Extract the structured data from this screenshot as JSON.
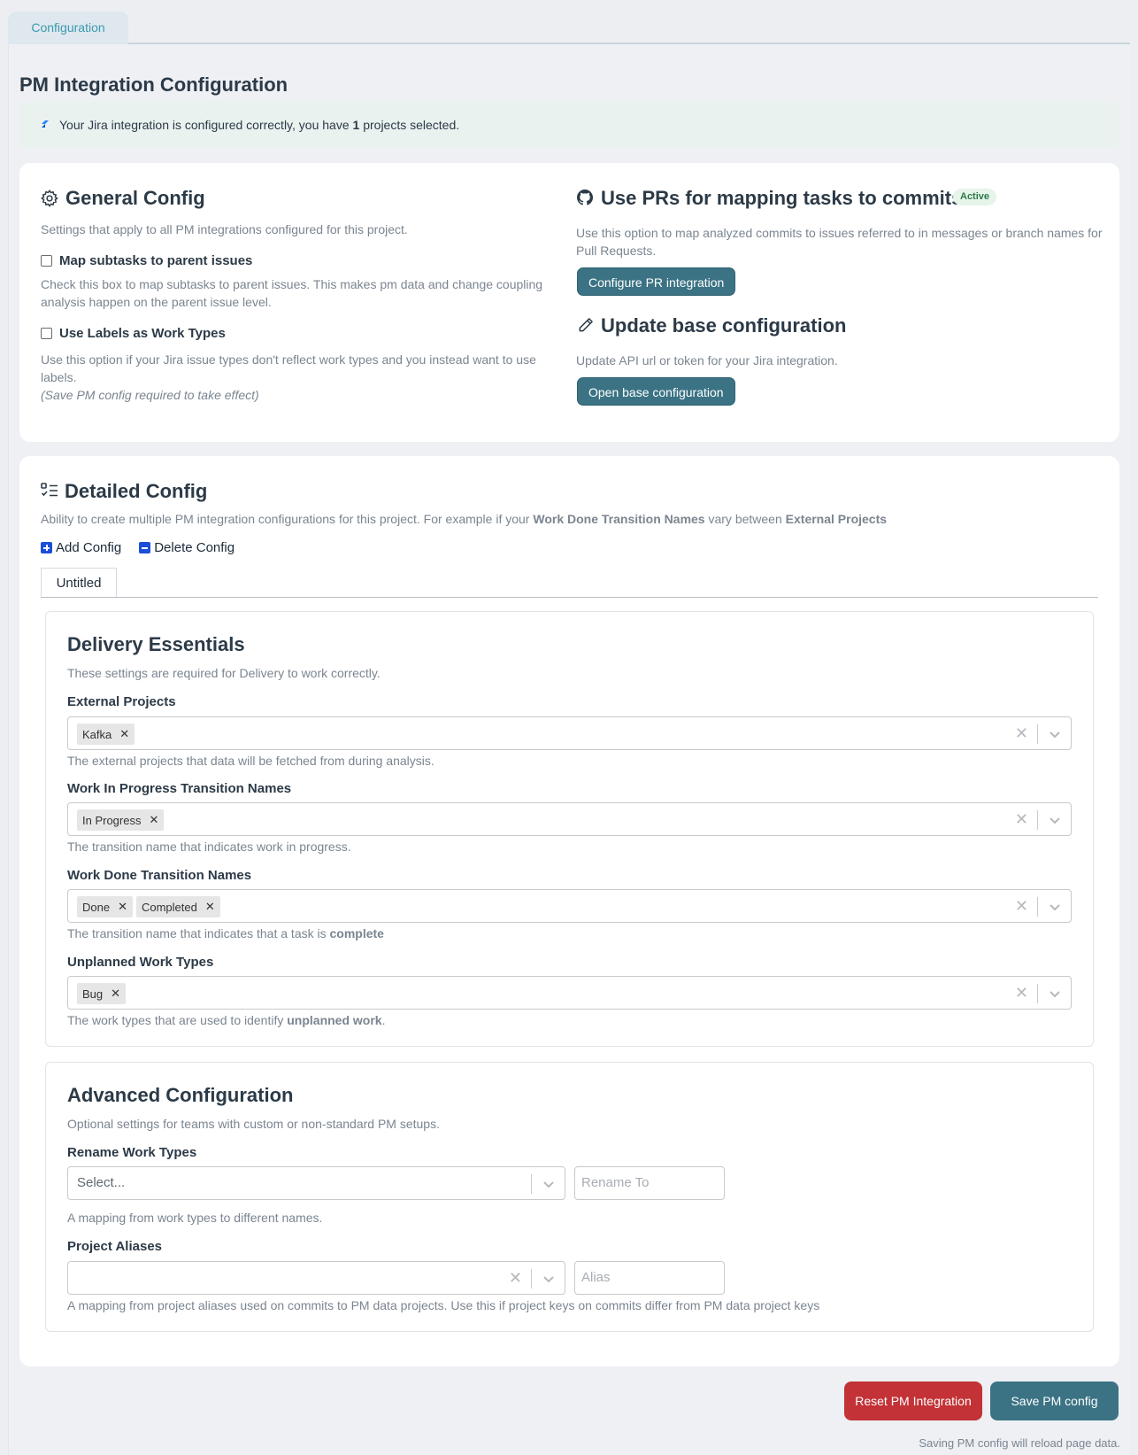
{
  "tabs": {
    "configuration": "Configuration"
  },
  "page": {
    "title": "PM Integration Configuration"
  },
  "alert": {
    "icon": "jira-icon",
    "text_before": "Your Jira integration is configured correctly, you have",
    "count": "1",
    "text_after": "projects selected."
  },
  "general": {
    "icon": "gear-icon",
    "title": "General Config",
    "description": "Settings that apply to all PM integrations configured for this project.",
    "map_subtasks": {
      "label": "Map subtasks to parent issues",
      "checked": false,
      "help": "Check this box to map subtasks to parent issues. This makes pm data and change coupling analysis happen on the parent issue level."
    },
    "use_labels": {
      "label": "Use Labels as Work Types",
      "checked": false,
      "help": "Use this option if your Jira issue types don't reflect work types and you instead want to use labels.",
      "note": "(Save PM config required to take effect)"
    }
  },
  "prs": {
    "icon": "github-icon",
    "title": "Use PRs for mapping tasks to commits",
    "badge": "Active",
    "description": "Use this option to map analyzed commits to issues referred to in messages or branch names for Pull Requests.",
    "button": "Configure PR integration"
  },
  "base": {
    "icon": "pencil-icon",
    "title": "Update base configuration",
    "description": "Update API url or token for your Jira integration.",
    "button": "Open base configuration"
  },
  "detailed": {
    "icon": "checklist-icon",
    "title": "Detailed Config",
    "desc_before": "Ability to create multiple PM integration configurations for this project. For example if your",
    "desc_bold1": "Work Done Transition Names",
    "desc_mid": "vary between",
    "desc_bold2": "External Projects",
    "add": "Add Config",
    "delete": "Delete Config",
    "tab": "Untitled"
  },
  "essentials": {
    "title": "Delivery Essentials",
    "description": "These settings are required for Delivery to work correctly.",
    "external_projects": {
      "label": "External Projects",
      "chips": [
        "Kafka"
      ],
      "help": "The external projects that data will be fetched from during analysis."
    },
    "wip": {
      "label": "Work In Progress Transition Names",
      "chips": [
        "In Progress"
      ],
      "help": "The transition name that indicates work in progress."
    },
    "done": {
      "label": "Work Done Transition Names",
      "chips": [
        "Done",
        "Completed"
      ],
      "help_before": "The transition name that indicates that a task is",
      "help_bold": "complete"
    },
    "unplanned": {
      "label": "Unplanned Work Types",
      "chips": [
        "Bug"
      ],
      "help_before": "The work types that are used to identify",
      "help_bold": "unplanned work",
      "help_after": "."
    }
  },
  "advanced": {
    "title": "Advanced Configuration",
    "description": "Optional settings for teams with custom or non-standard PM setups.",
    "rename": {
      "label": "Rename Work Types",
      "select_placeholder": "Select...",
      "input_placeholder": "Rename To",
      "help": "A mapping from work types to different names."
    },
    "aliases": {
      "label": "Project Aliases",
      "input_placeholder": "Alias",
      "help": "A mapping from project aliases used on commits to PM data projects. Use this if project keys on commits differ from PM data project keys"
    }
  },
  "footer": {
    "reset": "Reset PM Integration",
    "save": "Save PM config",
    "note": "Saving PM config will reload page data."
  },
  "colors": {
    "accent_teal": "#3b7384",
    "danger": "#c23236",
    "tab_text": "#3a9ab0",
    "badge_green": "#2c7a4b"
  }
}
